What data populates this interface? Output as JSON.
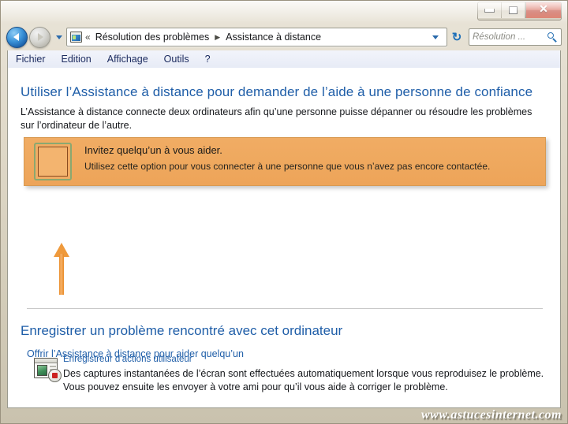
{
  "window": {
    "controls": {
      "minimize_label": "Réduire",
      "maximize_label": "Agrandir",
      "close_label": "✕"
    }
  },
  "navbar": {
    "back_label": "Précédent",
    "forward_label": "Suivant",
    "recent_pages_label": "Pages récentes",
    "address_chevron": "«",
    "breadcrumbs": [
      {
        "label": "Résolution des problèmes"
      },
      {
        "label": "Assistance à distance"
      }
    ],
    "breadcrumb_separator": "▶",
    "refresh_glyph": "↻",
    "search": {
      "placeholder": "Résolution ...",
      "value": ""
    }
  },
  "menubar": {
    "items": [
      {
        "label": "Fichier"
      },
      {
        "label": "Edition"
      },
      {
        "label": "Affichage"
      },
      {
        "label": "Outils"
      },
      {
        "label": "?"
      }
    ]
  },
  "main": {
    "page_title": "Utiliser l’Assistance à distance pour demander de l’aide à une personne de confiance",
    "page_description": "L’Assistance à distance connecte deux ordinateurs afin qu’une personne puisse dépanner ou résoudre les problèmes sur l’ordinateur de l’autre.",
    "option_panel": {
      "title": "Invitez quelqu’un à vous aider.",
      "subtitle": "Utilisez cette option pour vous connecter à une personne que vous n’avez pas encore contactée.",
      "icon_name": "invite-icon"
    },
    "offer_link": "Offrir l’Assistance à distance pour aider quelqu’un",
    "section2_title": "Enregistrer un problème rencontré avec cet ordinateur",
    "recorder": {
      "link": "Enregistreur d’actions utilisateur",
      "description": "Des captures instantanées de l’écran sont effectuées automatiquement lorsque vous reproduisez le problème. Vous pouvez ensuite les envoyer à votre ami pour qu’il vous aide à corriger le problème."
    }
  },
  "watermark": {
    "text": "www.astucesinternet.com"
  },
  "colors": {
    "accent_link": "#1f5ea8",
    "highlight_panel": "#efa95f",
    "arrow": "#ef9a3c",
    "close_button": "#b93322"
  }
}
